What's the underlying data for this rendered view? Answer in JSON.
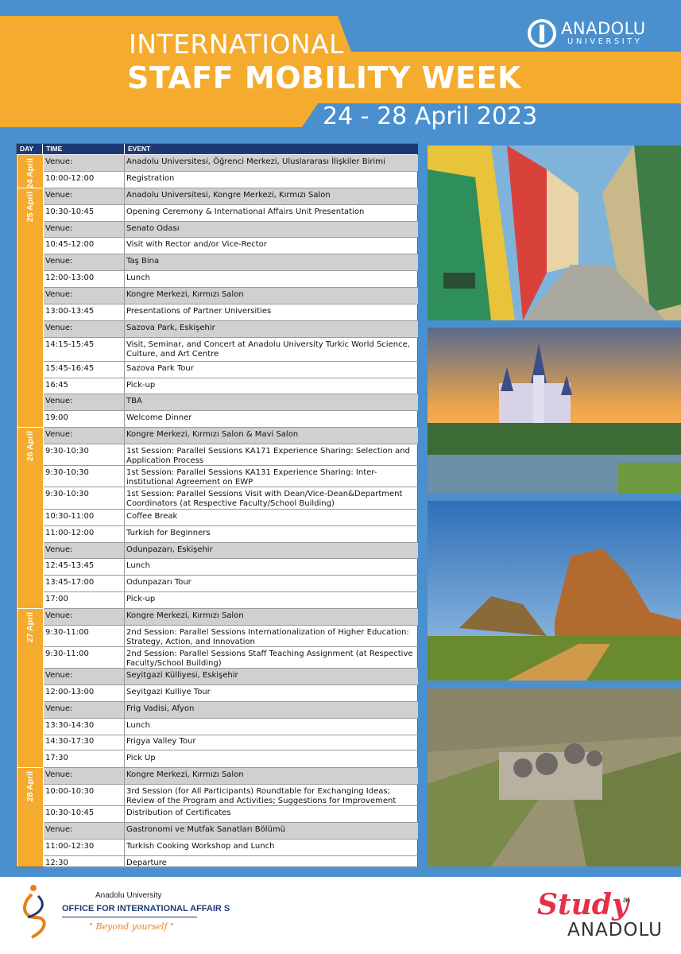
{
  "header": {
    "line1": "INTERNATIONAL",
    "line2": "STAFF MOBILITY WEEK",
    "dates": "24 - 28 April 2023",
    "logo_name": "ANADOLU",
    "logo_sub": "UNIVERSITY"
  },
  "table": {
    "headers": {
      "day": "DAY",
      "time": "TIME",
      "event": "EVENT"
    },
    "days": [
      {
        "label": "24 April"
      },
      {
        "label": "25 April"
      },
      {
        "label": "26 April"
      },
      {
        "label": "27 April"
      },
      {
        "label": "28 April"
      }
    ],
    "rows": [
      {
        "time": "Venue:",
        "event": "Anadolu Universitesi, Öğrenci Merkezi, Uluslararası İlişkiler Birimi"
      },
      {
        "time": "10:00-12:00",
        "event": "Registration"
      },
      {
        "time": "Venue:",
        "event": "Anadolu Universitesi, Kongre Merkezi, Kırmızı Salon"
      },
      {
        "time": "10:30-10:45",
        "event": "Opening Ceremony & International Affairs Unit Presentation"
      },
      {
        "time": "Venue:",
        "event": "Senato Odası"
      },
      {
        "time": "10:45-12:00",
        "event": "Visit with Rector and/or Vice-Rector"
      },
      {
        "time": "Venue:",
        "event": "Taş Bina"
      },
      {
        "time": "12:00-13:00",
        "event": "Lunch"
      },
      {
        "time": "Venue:",
        "event": "Kongre Merkezi, Kırmızı Salon"
      },
      {
        "time": "13:00-13:45",
        "event": "Presentations of Partner Universities"
      },
      {
        "time": "Venue:",
        "event": "Sazova Park, Eskişehir"
      },
      {
        "time": "14:15-15:45",
        "event": "Visit, Seminar, and Concert at Anadolu University Turkic World Science, Culture, and Art Centre"
      },
      {
        "time": "15:45-16:45",
        "event": "Sazova Park Tour"
      },
      {
        "time": "16:45",
        "event": "Pick-up"
      },
      {
        "time": "Venue:",
        "event": "TBA"
      },
      {
        "time": "19:00",
        "event": "Welcome Dinner"
      },
      {
        "time": "Venue:",
        "event": "Kongre Merkezi, Kırmızı Salon & Mavi Salon"
      },
      {
        "time": "9:30-10:30",
        "event": "1st Session: Parallel Sessions KA171 Experience Sharing: Selection and Application Process"
      },
      {
        "time": "9:30-10:30",
        "event": "1st Session: Parallel Sessions KA131 Experience Sharing: Inter-institutional Agreement on EWP"
      },
      {
        "time": "9:30-10:30",
        "event": "1st Session: Parallel Sessions Visit with Dean/Vice-Dean&Department Coordinators (at Respective Faculty/School Building)"
      },
      {
        "time": "10:30-11:00",
        "event": "Coffee Break"
      },
      {
        "time": "11:00-12:00",
        "event": "Turkish for Beginners"
      },
      {
        "time": "Venue:",
        "event": "Odunpazarı, Eskişehir"
      },
      {
        "time": "12:45-13:45",
        "event": "Lunch"
      },
      {
        "time": "13:45-17:00",
        "event": "Odunpazarı Tour"
      },
      {
        "time": "17:00",
        "event": "Pick-up"
      },
      {
        "time": "Venue:",
        "event": "Kongre Merkezi, Kırmızı Salon"
      },
      {
        "time": "9:30-11:00",
        "event": "2nd Session: Parallel Sessions Internationalization of Higher Education: Strategy, Action, and Innovation"
      },
      {
        "time": "9:30-11:00",
        "event": "2nd Session: Parallel Sessions Staff Teaching Assignment (at Respective Faculty/School Building)"
      },
      {
        "time": "Venue:",
        "event": "Seyitgazi Külliyesi, Eskişehir"
      },
      {
        "time": "12:00-13:00",
        "event": "Seyitgazi Kulliye Tour"
      },
      {
        "time": "Venue:",
        "event": "Frig Vadisi, Afyon"
      },
      {
        "time": "13:30-14:30",
        "event": "Lunch"
      },
      {
        "time": "14:30-17:30",
        "event": "Frigya Valley Tour"
      },
      {
        "time": "17:30",
        "event": "Pick Up"
      },
      {
        "time": "Venue:",
        "event": "Kongre Merkezi, Kırmızı Salon"
      },
      {
        "time": "10:00-10:30",
        "event": "3rd Session (for All Participants) Roundtable for Exchanging Ideas; Review of the Program and Activities; Suggestions for Improvement"
      },
      {
        "time": "10:30-10:45",
        "event": "Distribution of Certificates"
      },
      {
        "time": "Venue:",
        "event": "Gastronomi ve Mutfak Sanatları Bölümü"
      },
      {
        "time": "11:00-12:30",
        "event": "Turkish Cooking Workshop and Lunch"
      },
      {
        "time": "12:30",
        "event": "Departure"
      }
    ]
  },
  "footer": {
    "university": "Anadolu University",
    "office": "OFFICE FOR INTERNATIONAL AFFAIR S",
    "slogan": "\" Beyond yourself \"",
    "study": "Study",
    "study_at": "at",
    "study_anadolu": "ANADOLU"
  },
  "colors": {
    "accent": "#f5ab2e",
    "background": "#4a90cf",
    "navy": "#1f3a72"
  }
}
